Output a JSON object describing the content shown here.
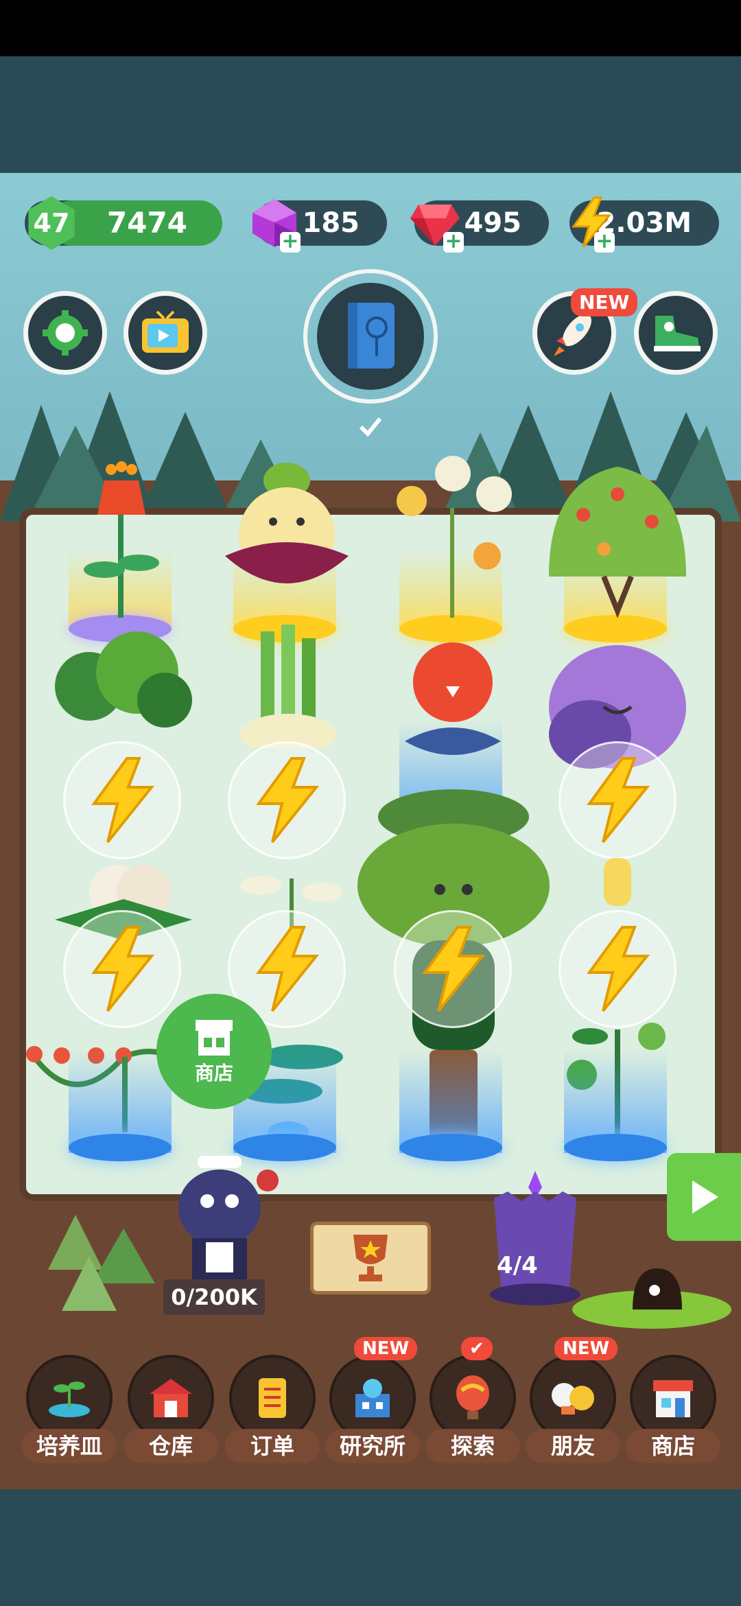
{
  "resources": {
    "level": "47",
    "level_points": "7474",
    "purple_gems": "185",
    "red_gems": "495",
    "energy": "2.03M"
  },
  "top_buttons": {
    "rocket_badge": "NEW"
  },
  "garden": {
    "shop_float_label": "商店",
    "deliveries_counter": "0/200K",
    "crystal_counter": "4/4"
  },
  "bottom_nav": [
    {
      "label": "培养皿",
      "badge": "",
      "icon": "sprout-icon"
    },
    {
      "label": "仓库",
      "badge": "",
      "icon": "barn-icon"
    },
    {
      "label": "订单",
      "badge": "",
      "icon": "scroll-icon"
    },
    {
      "label": "研究所",
      "badge": "NEW",
      "icon": "lab-icon"
    },
    {
      "label": "探索",
      "badge": "✔",
      "icon": "balloon-icon"
    },
    {
      "label": "朋友",
      "badge": "NEW",
      "icon": "friends-icon"
    },
    {
      "label": "商店",
      "badge": "",
      "icon": "store-icon"
    }
  ],
  "colors": {
    "accent_green": "#4cb84e",
    "badge_red": "#f04a3a",
    "panel_dark": "#2e4b55",
    "gold": "#ffcd1f"
  }
}
